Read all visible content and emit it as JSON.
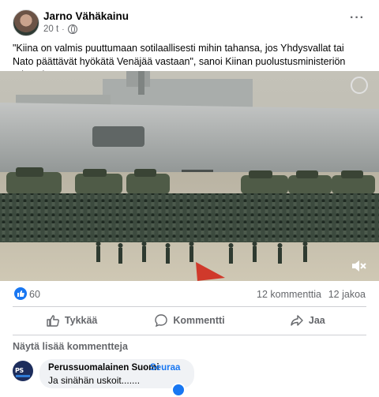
{
  "post": {
    "author": "Jarno Vähäkainu",
    "time": "20 t",
    "separator": "·",
    "more_label": "···",
    "text": "\"Kiina on valmis puuttumaan sotilaallisesti mihin tahansa, jos Yhdysvallat tai Nato päättävät hyökätä Venäjää vastaan\", sanoi Kiinan puolustusministeriön edustaja.",
    "icons": {
      "privacy": "globe-icon",
      "menu": "more-icon"
    }
  },
  "media": {
    "type": "video",
    "icons": {
      "volume": "mute-icon",
      "watermark": "watermark-icon"
    }
  },
  "stats": {
    "likes": "60",
    "comments": "12 kommenttia",
    "shares": "12 jakoa"
  },
  "actions": [
    {
      "label": "Tykkää",
      "icon": "thumbs-up-icon"
    },
    {
      "label": "Kommentti",
      "icon": "comment-icon"
    },
    {
      "label": "Jaa",
      "icon": "share-icon"
    }
  ],
  "comments_section": {
    "more_label": "Näytä lisää kommentteja",
    "comment": {
      "author": "Perussuomalainen Suomi",
      "follow_label": "Seuraa",
      "separator": "·",
      "text": "Ja sinähän uskoit.......",
      "avatar_text": "PS"
    }
  },
  "colors": {
    "accent": "#1877f2",
    "secondary_text": "#65676b",
    "bubble": "#f0f2f5"
  }
}
